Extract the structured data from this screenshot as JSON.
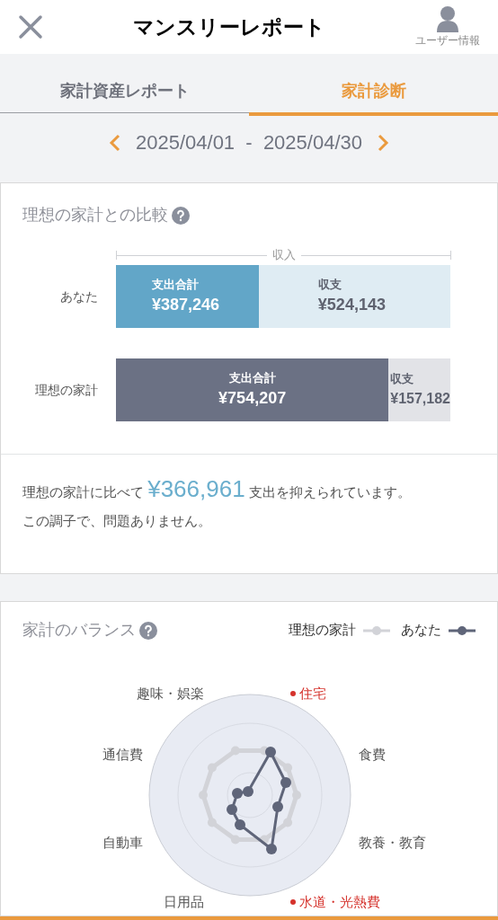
{
  "header": {
    "title": "マンスリーレポート",
    "user_label": "ユーザー情報"
  },
  "tabs": [
    {
      "label": "家計資産レポート",
      "selected": false
    },
    {
      "label": "家計診断",
      "selected": true
    }
  ],
  "period": {
    "range": "2025/04/01  -  2025/04/30"
  },
  "comparison": {
    "title": "理想の家計との比較",
    "income_label": "収入",
    "rows": [
      {
        "label": "あなた",
        "kind": "you",
        "expense_label": "支出合計",
        "expense": "¥387,246",
        "balance_label": "収支",
        "balance": "¥524,143",
        "level": 0.427
      },
      {
        "label": "理想の家計",
        "kind": "ideal",
        "expense_label": "支出合計",
        "expense": "¥754,207",
        "balance_label": "収支",
        "balance": "¥157,182",
        "level": 0.828
      }
    ],
    "message_before": "理想の家計に比べて",
    "message_amount": "¥366,961",
    "message_after": "支出を抑えられています。",
    "message_line2": "この調子で、問題ありません。"
  },
  "balance": {
    "title": "家計のバランス",
    "legend": [
      {
        "label": "理想の家計",
        "kind": "ideal"
      },
      {
        "label": "あなた",
        "kind": "you"
      }
    ],
    "categories": [
      {
        "label": "趣味・娯楽",
        "alert": false
      },
      {
        "label": "住宅",
        "alert": true
      },
      {
        "label": "通信費",
        "alert": false
      },
      {
        "label": "食費",
        "alert": false
      },
      {
        "label": "自動車",
        "alert": false
      },
      {
        "label": "教養・教育",
        "alert": false
      },
      {
        "label": "日用品",
        "alert": false
      },
      {
        "label": "水道・光熱費",
        "alert": true
      }
    ]
  }
}
